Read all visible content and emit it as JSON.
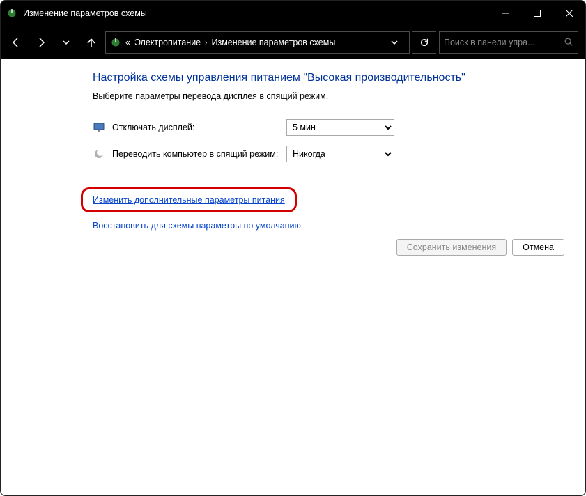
{
  "window": {
    "title": "Изменение параметров схемы"
  },
  "breadcrumb": {
    "prefix": "«",
    "seg1": "Электропитание",
    "seg2": "Изменение параметров схемы"
  },
  "search": {
    "placeholder": "Поиск в панели упра..."
  },
  "page": {
    "heading": "Настройка схемы управления питанием \"Высокая производительность\"",
    "subheading": "Выберите параметры перевода дисплея в спящий режим."
  },
  "settings": {
    "display_off_label": "Отключать дисплей:",
    "display_off_value": "5 мин",
    "sleep_label": "Переводить компьютер в спящий режим:",
    "sleep_value": "Никогда"
  },
  "links": {
    "advanced": "Изменить дополнительные параметры питания",
    "restore": "Восстановить для схемы параметры по умолчанию"
  },
  "buttons": {
    "save": "Сохранить изменения",
    "cancel": "Отмена"
  }
}
